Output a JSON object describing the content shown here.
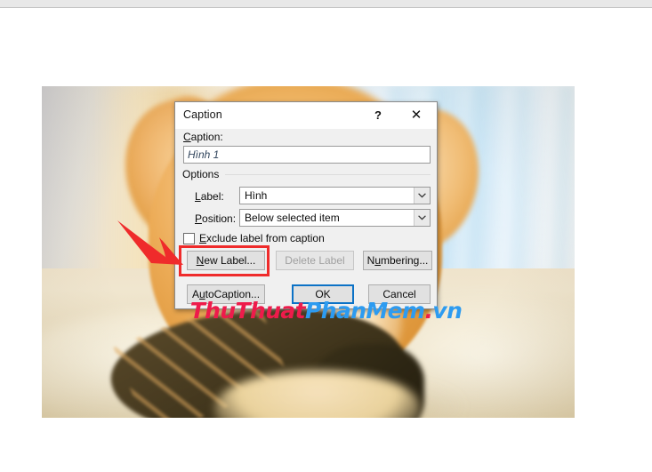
{
  "photo": {
    "description": "plush shiba dog toy on cream bedding with bright window behind"
  },
  "dialog": {
    "title": "Caption",
    "help_icon": "?",
    "close_icon": "✕",
    "caption_field": {
      "label": "Caption:",
      "label_accel": "C",
      "label_rest": "aption:",
      "value": "Hình 1"
    },
    "options": {
      "group_label": "Options",
      "label_field": {
        "label_accel": "L",
        "label_rest": "abel:",
        "value": "Hình",
        "arrow_icon": "chevron-down-icon"
      },
      "position_field": {
        "label_accel": "P",
        "label_rest": "osition:",
        "value": "Below selected item",
        "arrow_icon": "chevron-down-icon"
      },
      "exclude_checkbox": {
        "label_accel": "E",
        "label_rest": "xclude label from caption",
        "checked": false
      }
    },
    "buttons": {
      "new_label": {
        "accel": "N",
        "rest": "ew Label..."
      },
      "delete_label": {
        "label": "Delete Label",
        "disabled": true
      },
      "numbering": {
        "pre": "N",
        "accel": "u",
        "rest": "mbering..."
      },
      "autocaption": {
        "pre": "A",
        "accel": "u",
        "rest": "toCaption..."
      },
      "ok": {
        "label": "OK",
        "is_default": true
      },
      "cancel": {
        "label": "Cancel"
      }
    }
  },
  "annotation": {
    "arrow_color": "#ef2b2b",
    "highlight_color": "#ef2b2b",
    "points_at": "new-label-button"
  },
  "watermark": {
    "part1": "ThuThuat",
    "part2": "PhanMem",
    "part3": ".",
    "part4": "vn",
    "color_red": "#ee1b4b",
    "color_blue": "#2d9bf0"
  }
}
